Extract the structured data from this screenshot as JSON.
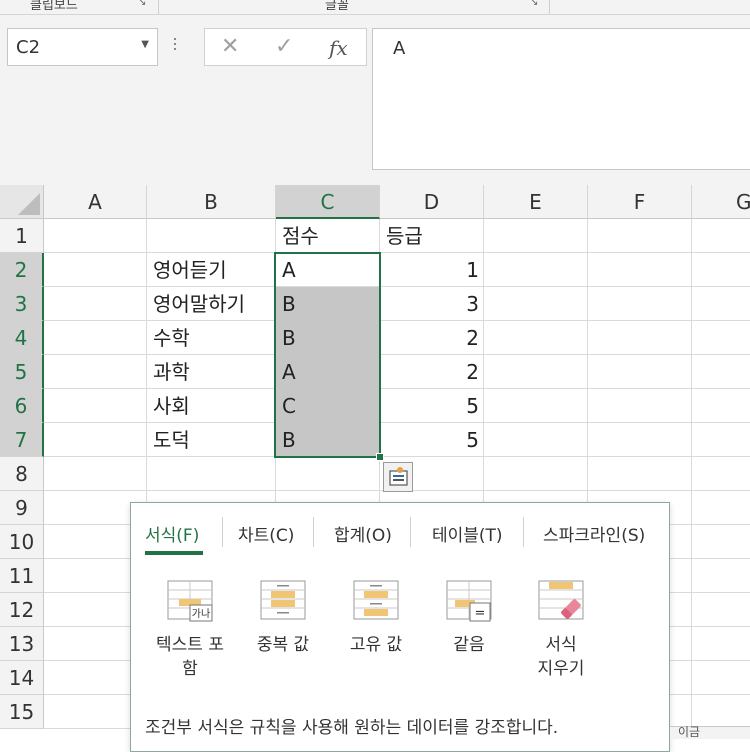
{
  "ribbon": {
    "group_left": "클립보드",
    "group_mid": "글꼴",
    "launcher_icon": "dialog-launcher-icon"
  },
  "formula_bar": {
    "name_box": "C2",
    "cancel_icon": "close-icon",
    "enter_icon": "check-icon",
    "fx_label": "fx",
    "content": "A"
  },
  "grid": {
    "columns": [
      "A",
      "B",
      "C",
      "D",
      "E",
      "F",
      "G"
    ],
    "selected_column": "C",
    "rows": [
      "1",
      "2",
      "3",
      "4",
      "5",
      "6",
      "7",
      "8",
      "9",
      "10",
      "11",
      "12",
      "13",
      "14",
      "15"
    ],
    "selected_rows": [
      "2",
      "3",
      "4",
      "5",
      "6",
      "7"
    ],
    "header": {
      "C": "점수",
      "D": "등급"
    },
    "data": [
      {
        "subject": "영어듣기",
        "score": "A",
        "grade": "1"
      },
      {
        "subject": "영어말하기",
        "score": "B",
        "grade": "3"
      },
      {
        "subject": "수학",
        "score": "B",
        "grade": "2"
      },
      {
        "subject": "과학",
        "score": "A",
        "grade": "2"
      },
      {
        "subject": "사회",
        "score": "C",
        "grade": "5"
      },
      {
        "subject": "도덕",
        "score": "B",
        "grade": "5"
      }
    ]
  },
  "quick_analysis": {
    "button_icon": "quick-analysis-icon",
    "tabs": [
      "서식(F)",
      "차트(C)",
      "합계(O)",
      "테이블(T)",
      "스파크라인(S)"
    ],
    "active_tab": "서식(F)",
    "items": [
      {
        "line1": "텍스트 포",
        "line2": "함",
        "icon": "text-contains-icon",
        "badge": "가나"
      },
      {
        "line1": "중복 값",
        "line2": "",
        "icon": "duplicate-values-icon",
        "badge": ""
      },
      {
        "line1": "고유 값",
        "line2": "",
        "icon": "unique-values-icon",
        "badge": ""
      },
      {
        "line1": "같음",
        "line2": "",
        "icon": "equal-to-icon",
        "badge": "="
      },
      {
        "line1": "서식",
        "line2": "지우기",
        "icon": "clear-format-icon",
        "badge": ""
      }
    ],
    "description": "조건부 서식은 규칙을 사용해 원하는 데이터를 강조합니다."
  },
  "status_bar": {
    "partial_text": "이금"
  },
  "colors": {
    "accent": "#217346",
    "selection_fill": "#c6c6c6",
    "highlight": "#f0c674",
    "eraser": "#e8869a"
  }
}
